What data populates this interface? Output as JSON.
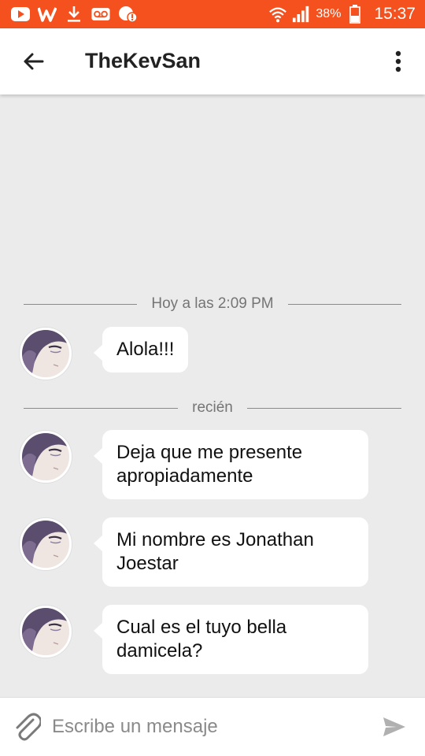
{
  "status_bar": {
    "battery_percent": "38%",
    "time": "15:37",
    "icons": [
      "youtube-icon",
      "w-icon",
      "download-icon",
      "voicemail-icon",
      "alert-icon",
      "wifi-icon",
      "signal-icon",
      "battery-icon"
    ]
  },
  "app_bar": {
    "title": "TheKevSan",
    "back_icon": "arrow-back-icon",
    "menu_icon": "more-vert-icon"
  },
  "chat": {
    "dividers": [
      {
        "label": "Hoy a las 2:09 PM"
      },
      {
        "label": "recién"
      }
    ],
    "messages": [
      {
        "text": "Alola!!!"
      },
      {
        "line1": "Deja que me presente",
        "line2": "apropiadamente"
      },
      {
        "line1": "Mi nombre es Jonathan",
        "line2": "Joestar"
      },
      {
        "line1": "Cual es el tuyo bella",
        "line2": "damicela?"
      }
    ]
  },
  "input_bar": {
    "placeholder": "Escribe un mensaje",
    "attach_icon": "paperclip-icon",
    "send_icon": "send-icon"
  },
  "colors": {
    "status_bar": "#f4511e",
    "background": "#ebebeb",
    "bubble": "#ffffff"
  }
}
